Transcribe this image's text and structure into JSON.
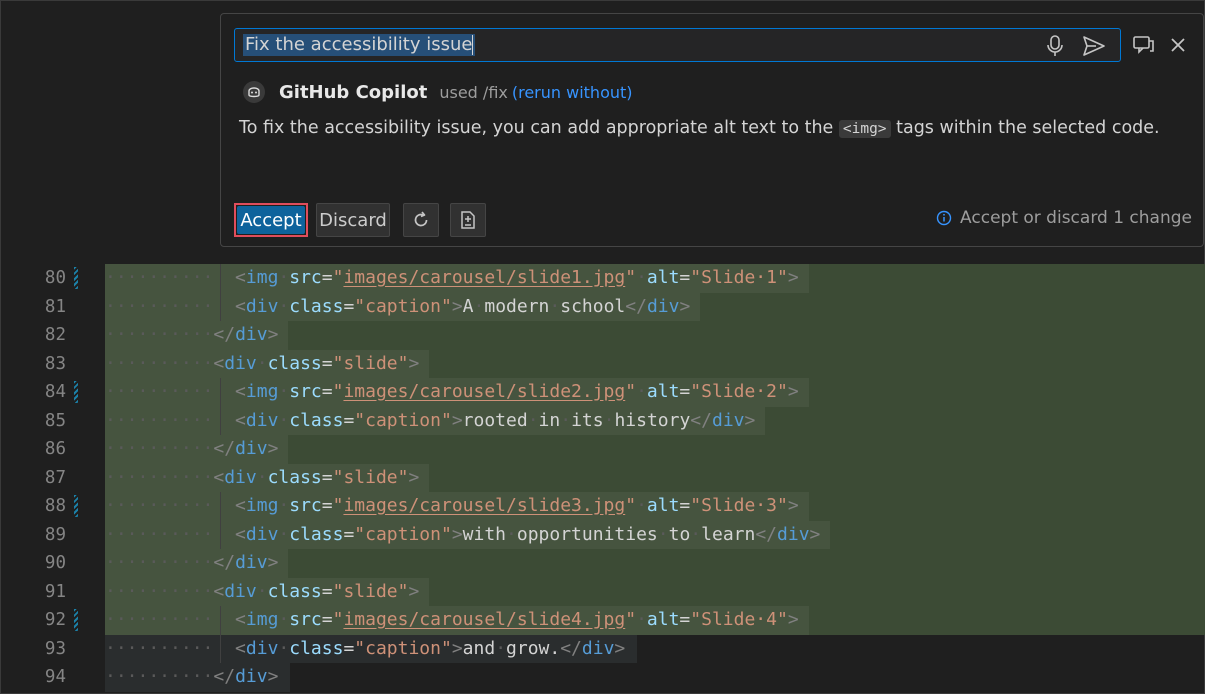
{
  "chat": {
    "prompt_value": "Fix the accessibility issue",
    "agent_name": "GitHub Copilot",
    "used_text": "used /fix",
    "rerun_link": "(rerun without)",
    "response_before": "To fix the accessibility issue, you can add appropriate alt text to the ",
    "response_code": "<img>",
    "response_after": " tags within the selected code.",
    "accept_label": "Accept",
    "discard_label": "Discard",
    "status_text": "Accept or discard 1 change",
    "icons": [
      "mic-icon",
      "send-icon",
      "view-in-panel-icon",
      "close-icon",
      "copilot-icon",
      "refresh-icon",
      "diff-icon",
      "info-icon"
    ]
  },
  "colors": {
    "accent": "#0e639c",
    "focus_border": "#0078d4",
    "highlight_outline": "#e04d5c",
    "inserted_bg": "#3c4b35",
    "link": "#3794ff"
  },
  "editor": {
    "lines": [
      {
        "num": "80",
        "indent": "··········  ",
        "tag": "img",
        "src": "images/carousel/slide1.jpg",
        "alt": "Slide 1"
      },
      {
        "num": "81",
        "indent": "··········  ",
        "caption": "A modern school"
      },
      {
        "num": "82",
        "indent": "··········",
        "close": "div"
      },
      {
        "num": "83",
        "indent": "··········",
        "slide": "slide"
      },
      {
        "num": "84",
        "indent": "··········  ",
        "tag": "img",
        "src": "images/carousel/slide2.jpg",
        "alt": "Slide 2"
      },
      {
        "num": "85",
        "indent": "··········  ",
        "caption": "rooted in its history"
      },
      {
        "num": "86",
        "indent": "··········",
        "close": "div"
      },
      {
        "num": "87",
        "indent": "··········",
        "slide": "slide"
      },
      {
        "num": "88",
        "indent": "··········  ",
        "tag": "img",
        "src": "images/carousel/slide3.jpg",
        "alt": "Slide 3"
      },
      {
        "num": "89",
        "indent": "··········  ",
        "caption": "with opportunities to learn"
      },
      {
        "num": "90",
        "indent": "··········",
        "close": "div"
      },
      {
        "num": "91",
        "indent": "··········",
        "slide": "slide"
      },
      {
        "num": "92",
        "indent": "··········  ",
        "tag": "img",
        "src": "images/carousel/slide4.jpg",
        "alt": "Slide 4"
      },
      {
        "num": "93",
        "indent": "··········  ",
        "caption": "and grow."
      },
      {
        "num": "94",
        "indent": "··········",
        "close": "div"
      }
    ]
  }
}
